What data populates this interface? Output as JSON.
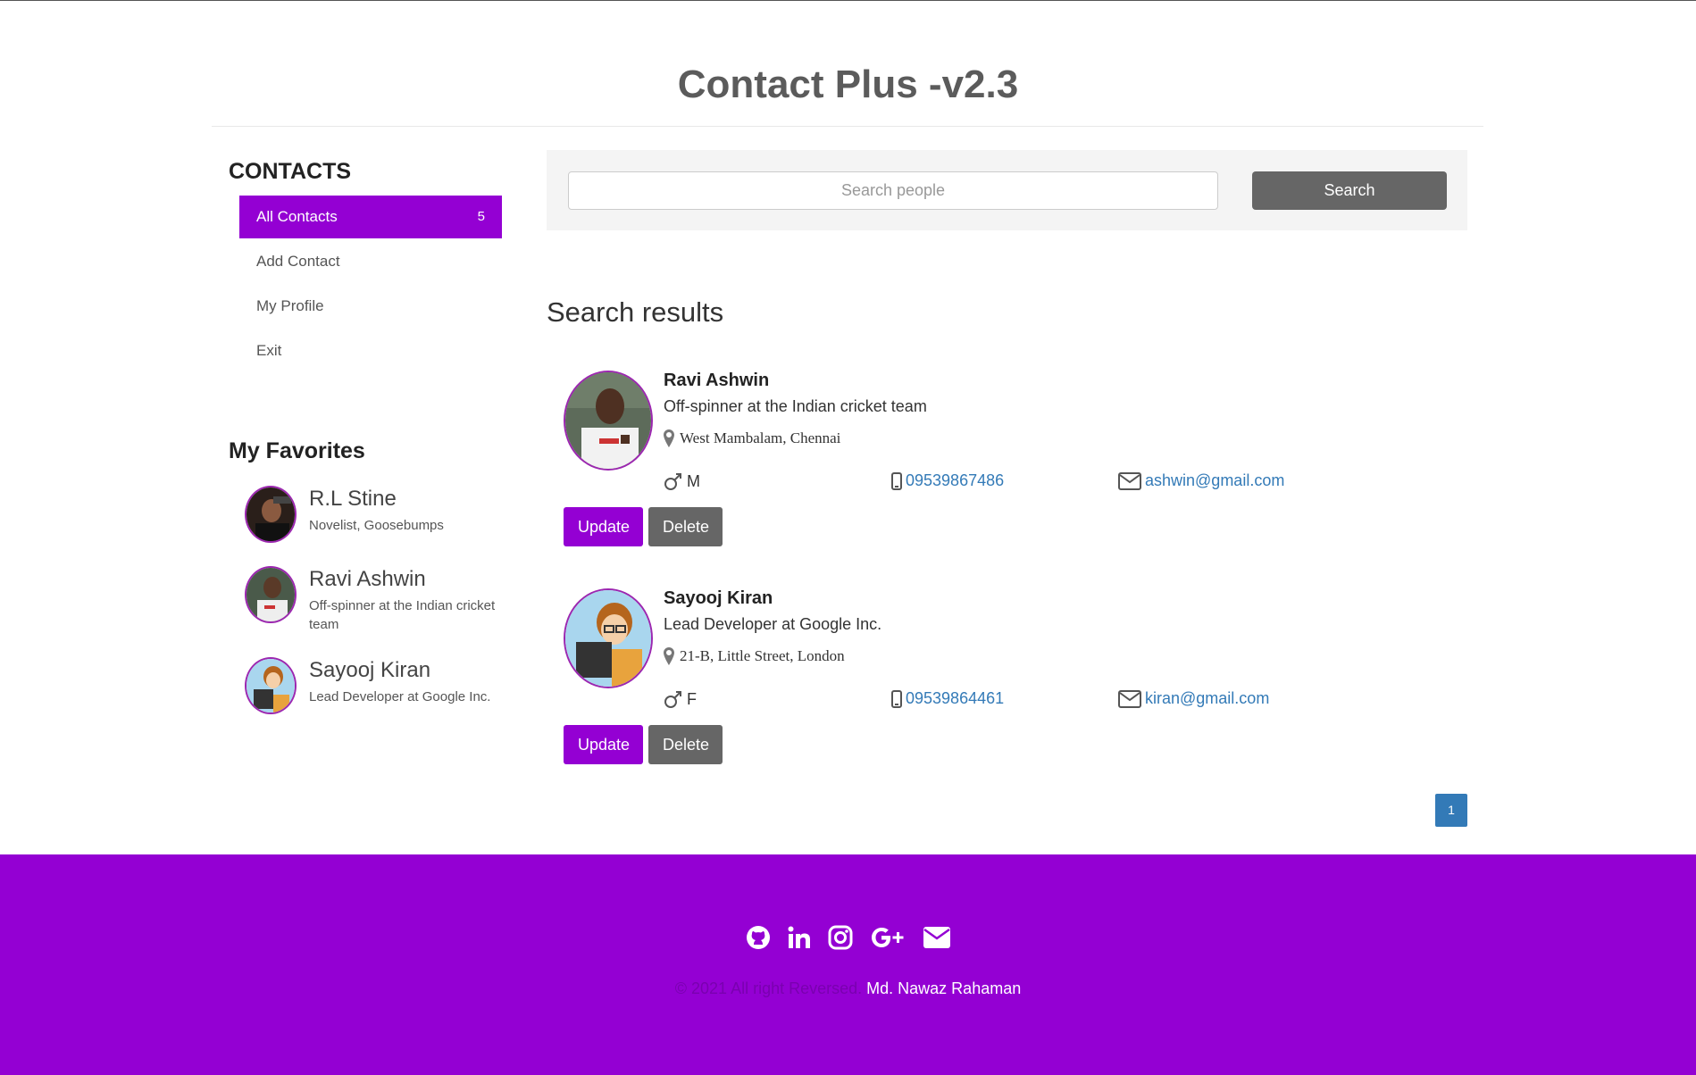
{
  "header": {
    "title": "Contact Plus -v2.3"
  },
  "sidebar": {
    "title": "CONTACTS",
    "items": [
      {
        "label": "All Contacts",
        "count": "5"
      },
      {
        "label": "Add Contact"
      },
      {
        "label": "My Profile"
      },
      {
        "label": "Exit"
      }
    ],
    "favorites_title": "My Favorites",
    "favorites": [
      {
        "name": "R.L Stine",
        "desc": "Novelist, Goosebumps"
      },
      {
        "name": "Ravi Ashwin",
        "desc": "Off-spinner at the Indian cricket team"
      },
      {
        "name": "Sayooj Kiran",
        "desc": "Lead Developer at Google Inc."
      }
    ]
  },
  "search": {
    "placeholder": "Search people",
    "button": "Search"
  },
  "results": {
    "title": "Search results",
    "items": [
      {
        "name": "Ravi Ashwin",
        "title": "Off-spinner at the Indian cricket team",
        "address": "West Mambalam, Chennai",
        "gender": "M",
        "phone": "09539867486",
        "email": "ashwin@gmail.com",
        "update": "Update",
        "delete": "Delete"
      },
      {
        "name": "Sayooj Kiran",
        "title": "Lead Developer at Google Inc.",
        "address": "21-B, Little Street, London",
        "gender": "F",
        "phone": "09539864461",
        "email": "kiran@gmail.com",
        "update": "Update",
        "delete": "Delete"
      }
    ]
  },
  "pagination": {
    "current": "1"
  },
  "footer": {
    "icons": [
      "github-icon",
      "linkedin-icon",
      "instagram-icon",
      "google-plus-icon",
      "envelope-icon"
    ],
    "copyright": "© 2021 All right Reversed.",
    "author": "Md. Nawaz Rahaman"
  },
  "colors": {
    "accent": "#9400d3",
    "link": "#337ab7",
    "gray_button": "#666666"
  }
}
